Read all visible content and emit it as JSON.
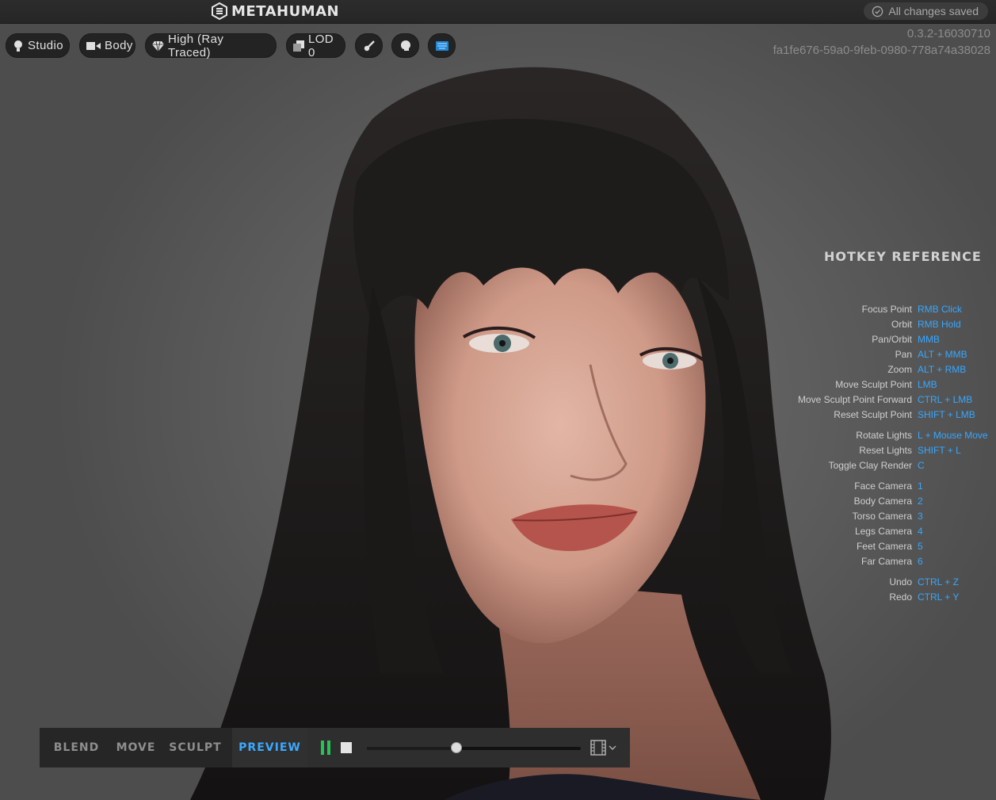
{
  "app": {
    "logo_text": "METAHUMAN",
    "logo_icon": "metahuman-logo-icon",
    "save_status": "All changes saved",
    "save_icon": "check-circle-icon"
  },
  "toolbar": {
    "lighting": {
      "label": "Studio",
      "icon": "lightbulb-icon"
    },
    "camera": {
      "label": "Body",
      "icon": "video-camera-icon"
    },
    "quality": {
      "label": "High (Ray Traced)",
      "icon": "diamond-icon"
    },
    "lod": {
      "label": "LOD 0",
      "icon": "layers-icon"
    },
    "tools": [
      {
        "icon": "brush-icon"
      },
      {
        "icon": "head-clay-icon"
      },
      {
        "icon": "keyboard-icon"
      }
    ]
  },
  "version": {
    "number": "0.3.2-16030710",
    "id": "fa1fe676-59a0-9feb-0980-778a74a38028"
  },
  "hotkeys": {
    "title": "HOTKEY REFERENCE",
    "items": [
      {
        "label": "Focus Point",
        "key": "RMB Click"
      },
      {
        "label": "Orbit",
        "key": "RMB Hold"
      },
      {
        "label": "Pan/Orbit",
        "key": "MMB"
      },
      {
        "label": "Pan",
        "key": "ALT + MMB"
      },
      {
        "label": "Zoom",
        "key": "ALT + RMB"
      },
      {
        "label": "Move Sculpt Point",
        "key": "LMB"
      },
      {
        "label": "Move Sculpt Point Forward",
        "key": "CTRL + LMB"
      },
      {
        "label": "Reset Sculpt Point",
        "key": "SHIFT + LMB"
      },
      {
        "label": "Rotate Lights",
        "key": "L + Mouse Move"
      },
      {
        "label": "Reset Lights",
        "key": "SHIFT + L"
      },
      {
        "label": "Toggle Clay Render",
        "key": "C"
      },
      {
        "label": "Face Camera",
        "key": "1"
      },
      {
        "label": "Body Camera",
        "key": "2"
      },
      {
        "label": "Torso Camera",
        "key": "3"
      },
      {
        "label": "Legs Camera",
        "key": "4"
      },
      {
        "label": "Feet Camera",
        "key": "5"
      },
      {
        "label": "Far Camera",
        "key": "6"
      },
      {
        "label": "Undo",
        "key": "CTRL + Z"
      },
      {
        "label": "Redo",
        "key": "CTRL + Y"
      }
    ]
  },
  "modes": {
    "blend": "BLEND",
    "move": "MOVE",
    "sculpt": "SCULPT",
    "preview": "PREVIEW",
    "active": "PREVIEW"
  },
  "playback": {
    "state": "playing",
    "pause_icon": "pause-icon",
    "stop_icon": "stop-icon",
    "progress": 0.42,
    "film_icon": "film-strip-icon",
    "dropdown_icon": "chevron-down-icon"
  },
  "colors": {
    "accent": "#37a7ff",
    "play_green": "#26c454",
    "bar_bg": "#262626"
  }
}
